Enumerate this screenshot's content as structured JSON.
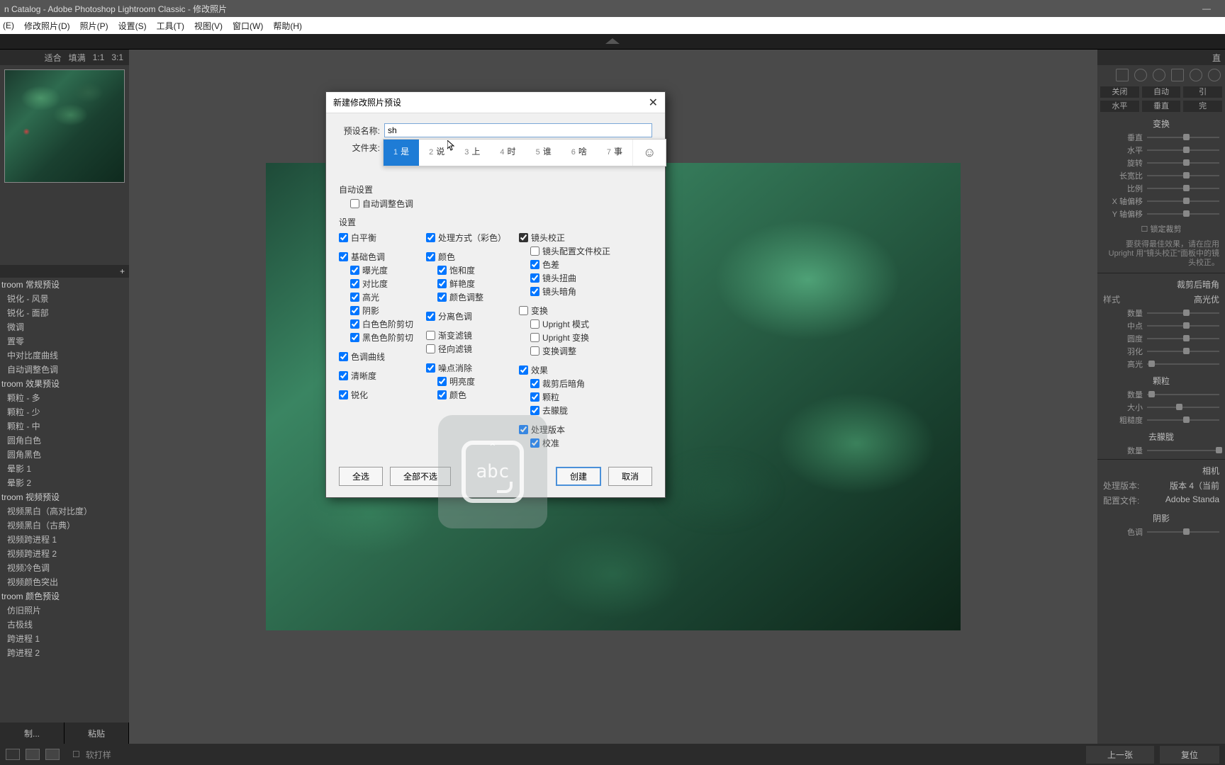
{
  "window": {
    "title": "n Catalog - Adobe Photoshop Lightroom Classic - 修改照片",
    "minimize": "—"
  },
  "menu": {
    "edit": "(E)",
    "develop": "修改照片(D)",
    "photo": "照片(P)",
    "settings": "设置(S)",
    "tools": "工具(T)",
    "view": "视图(V)",
    "window": "窗口(W)",
    "help": "帮助(H)"
  },
  "nav": {
    "fit": "适合",
    "fill": "填满",
    "r1": "1:1",
    "r3": "3:1"
  },
  "presets": {
    "groups": [
      "troom 常规预设",
      "锐化 - 风景",
      "锐化 - 面部",
      "微调",
      "置零",
      "中对比度曲线",
      "自动调整色调",
      "troom 效果预设",
      "颗粒 - 多",
      "颗粒 - 少",
      "颗粒 - 中",
      "圆角白色",
      "圆角黑色",
      "晕影 1",
      "晕影 2",
      "troom 视频预设",
      "视频黑白（高对比度）",
      "视频黑白（古典）",
      "视频跨进程 1",
      "视频跨进程 2",
      "视频冷色调",
      "视频颜色突出",
      "troom 颜色预设",
      "仿旧照片",
      "古极线",
      "跨进程 1",
      "跨进程 2"
    ],
    "add": "+"
  },
  "leftfoot": {
    "copy": "制...",
    "paste": "粘贴"
  },
  "right": {
    "hdr": "直",
    "row1": {
      "close": "关闭",
      "auto": "自动",
      "lead": "引"
    },
    "row2": {
      "h": "水平",
      "v": "垂直",
      "done": "完"
    },
    "transform": "变换",
    "sliders1": [
      "垂直",
      "水平",
      "旋转",
      "长宽比",
      "比例",
      "X 轴偏移",
      "Y 轴偏移"
    ],
    "lock": "锁定裁剪",
    "hint": "要获得最佳效果，请在应用 Upright 用\"镜头校正\"面板中的镜头校正。",
    "vignette_title": "裁剪后暗角",
    "style_lbl": "样式",
    "style_v": "高光优",
    "sliders2": [
      "数量",
      "中点",
      "圆度",
      "羽化",
      "高光"
    ],
    "grain_title": "颗粒",
    "sliders3": [
      "数量",
      "大小",
      "粗糙度"
    ],
    "defr_title": "去朦胧",
    "sliders4": [
      "数量"
    ],
    "camera_title": "相机",
    "procver_lbl": "处理版本:",
    "procver_v": "版本 4（当前",
    "profile_lbl": "配置文件:",
    "profile_v": "Adobe Standa",
    "shadow_title": "阴影",
    "tint_lbl": "色调"
  },
  "bottombar": {
    "soft": "软打样",
    "prev": "上一张",
    "reset": "复位"
  },
  "dialog": {
    "title": "新建修改照片预设",
    "close": "✕",
    "name_lbl": "预设名称:",
    "name_val": "sh",
    "folder_lbl": "文件夹:",
    "autoset": "自动设置",
    "autotone": "自动调整色调",
    "settings": "设置",
    "col1": {
      "wb": "白平衡",
      "basic": "基础色调",
      "exp": "曝光度",
      "contrast": "对比度",
      "hl": "高光",
      "sh": "阴影",
      "wc": "白色色阶剪切",
      "bc": "黑色色阶剪切",
      "tonecurve": "色调曲线",
      "clarity": "清晰度",
      "sharp": "锐化"
    },
    "col2": {
      "treat": "处理方式（彩色）",
      "color": "颜色",
      "sat": "饱和度",
      "vib": "鲜艳度",
      "cadj": "颜色调整",
      "split": "分离色调",
      "grad": "渐变滤镜",
      "rad": "径向滤镜",
      "nr": "噪点消除",
      "lum": "明亮度",
      "ncol": "颜色"
    },
    "col3": {
      "lens": "镜头校正",
      "lprof": "镜头配置文件校正",
      "ca": "色差",
      "dist": "镜头扭曲",
      "vig": "镜头暗角",
      "trans": "变换",
      "upmode": "Upright 模式",
      "uptrans": "Upright 变换",
      "tadj": "变换调整",
      "fx": "效果",
      "pcv": "裁剪后暗角",
      "grain": "颗粒",
      "defr": "去朦胧",
      "pver": "处理版本",
      "calib": "校准"
    },
    "selall": "全选",
    "selnone": "全部不选",
    "create": "创建",
    "cancel": "取消"
  },
  "ime": {
    "cands": [
      {
        "n": "1",
        "t": "是"
      },
      {
        "n": "2",
        "t": "说"
      },
      {
        "n": "3",
        "t": "上"
      },
      {
        "n": "4",
        "t": "时"
      },
      {
        "n": "5",
        "t": "谁"
      },
      {
        "n": "6",
        "t": "啥"
      },
      {
        "n": "7",
        "t": "事"
      }
    ],
    "emoji": "☺"
  },
  "ime_float": "abc"
}
